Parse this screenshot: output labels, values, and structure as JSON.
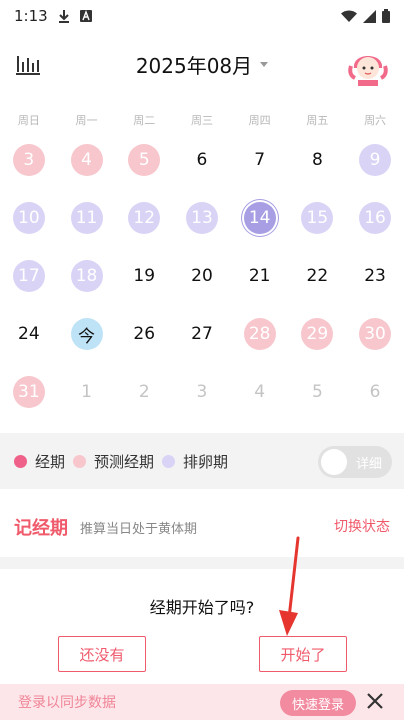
{
  "status_bar": {
    "time": "1:13",
    "icons": [
      "download-icon",
      "a-badge-icon",
      "wifi-icon",
      "signal-icon",
      "battery-icon"
    ]
  },
  "header": {
    "month_label": "2025年08月",
    "left_icon": "bar-chart-icon",
    "right_icon": "avatar-icon"
  },
  "weekdays": [
    "周日",
    "周一",
    "周二",
    "周三",
    "周四",
    "周五",
    "周六"
  ],
  "weeks": [
    [
      {
        "d": "3",
        "t": "pred"
      },
      {
        "d": "4",
        "t": "pred"
      },
      {
        "d": "5",
        "t": "pred"
      },
      {
        "d": "6",
        "t": ""
      },
      {
        "d": "7",
        "t": ""
      },
      {
        "d": "8",
        "t": ""
      },
      {
        "d": "9",
        "t": "ovu"
      }
    ],
    [
      {
        "d": "10",
        "t": "ovu"
      },
      {
        "d": "11",
        "t": "ovu"
      },
      {
        "d": "12",
        "t": "ovu"
      },
      {
        "d": "13",
        "t": "ovu"
      },
      {
        "d": "14",
        "t": "ovu-main"
      },
      {
        "d": "15",
        "t": "ovu"
      },
      {
        "d": "16",
        "t": "ovu"
      }
    ],
    [
      {
        "d": "17",
        "t": "ovu"
      },
      {
        "d": "18",
        "t": "ovu"
      },
      {
        "d": "19",
        "t": ""
      },
      {
        "d": "20",
        "t": ""
      },
      {
        "d": "21",
        "t": ""
      },
      {
        "d": "22",
        "t": ""
      },
      {
        "d": "23",
        "t": ""
      }
    ],
    [
      {
        "d": "24",
        "t": ""
      },
      {
        "d": "今",
        "t": "today"
      },
      {
        "d": "26",
        "t": ""
      },
      {
        "d": "27",
        "t": ""
      },
      {
        "d": "28",
        "t": "pred"
      },
      {
        "d": "29",
        "t": "pred"
      },
      {
        "d": "30",
        "t": "pred"
      }
    ],
    [
      {
        "d": "31",
        "t": "pred"
      },
      {
        "d": "1",
        "t": "next"
      },
      {
        "d": "2",
        "t": "next"
      },
      {
        "d": "3",
        "t": "next"
      },
      {
        "d": "4",
        "t": "next"
      },
      {
        "d": "5",
        "t": "next"
      },
      {
        "d": "6",
        "t": "next"
      }
    ]
  ],
  "legend": {
    "period": "经期",
    "predicted": "预测经期",
    "ovulation": "排卵期",
    "detail_toggle": "详细",
    "colors": {
      "period": "#f0618a",
      "predicted": "#f7c7cd",
      "ovulation": "#d9d3f6"
    }
  },
  "record": {
    "title": "记经期",
    "subtitle": "推算当日处于黄体期",
    "switch": "切换状态"
  },
  "prompt": {
    "question": "经期开始了吗?",
    "no_button": "还没有",
    "yes_button": "开始了"
  },
  "login_banner": {
    "text": "登录以同步数据",
    "quick_login": "快速登录"
  },
  "colors": {
    "accent": "#f05b6c",
    "today": "#bfe3f6",
    "ovulation_day": "#a79ee4"
  }
}
